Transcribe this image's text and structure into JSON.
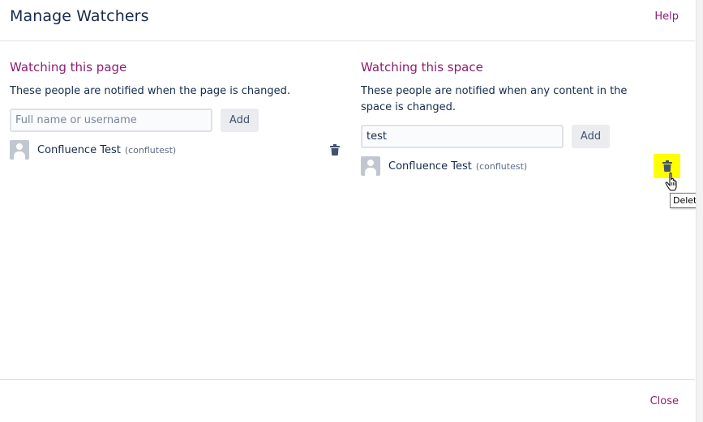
{
  "dialog": {
    "title": "Manage Watchers",
    "help_label": "Help",
    "close_label": "Close"
  },
  "page_section": {
    "heading": "Watching this page",
    "description": "These people are notified when the page is changed.",
    "input_value": "",
    "input_placeholder": "Full name or username",
    "add_label": "Add",
    "watchers": [
      {
        "name": "Confluence Test",
        "username": "(conflutest)"
      }
    ]
  },
  "space_section": {
    "heading": "Watching this space",
    "description": "These people are notified when any content in the space is changed.",
    "input_value": "test",
    "input_placeholder": "",
    "add_label": "Add",
    "watchers": [
      {
        "name": "Confluence Test",
        "username": "(conflutest)"
      }
    ]
  },
  "tooltip": {
    "text": "Delete"
  },
  "icons": {
    "delete": "trash-icon",
    "avatar": "user-avatar-icon",
    "cursor": "hand-pointer-icon"
  },
  "colors": {
    "accent": "#8e1d6e",
    "text": "#172b4d",
    "highlight": "#ffff00"
  }
}
